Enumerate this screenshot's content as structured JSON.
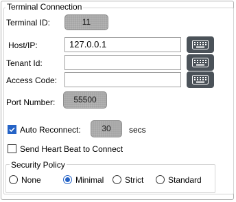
{
  "group_title": "Terminal Connection",
  "terminal_id": {
    "label": "Terminal ID:",
    "value": "11"
  },
  "host": {
    "label": "Host/IP:",
    "value": "127.0.0.1"
  },
  "tenant": {
    "label": "Tenant Id:",
    "value": ""
  },
  "access_code": {
    "label": "Access Code:",
    "value": ""
  },
  "port": {
    "label": "Port Number:",
    "value": "55500"
  },
  "auto_reconnect": {
    "label": "Auto Reconnect:",
    "checked": true,
    "value": "30",
    "unit": "secs"
  },
  "heartbeat": {
    "label": "Send Heart Beat to Connect",
    "checked": false
  },
  "security_policy": {
    "title": "Security Policy",
    "options": [
      "None",
      "Minimal",
      "Strict",
      "Standard"
    ],
    "selected": "Minimal"
  },
  "colors": {
    "accent": "#2563c6",
    "keyboard_button": "#4b5259",
    "pill": "#a6a6a6"
  },
  "icons": {
    "keyboard": "keyboard-icon"
  }
}
